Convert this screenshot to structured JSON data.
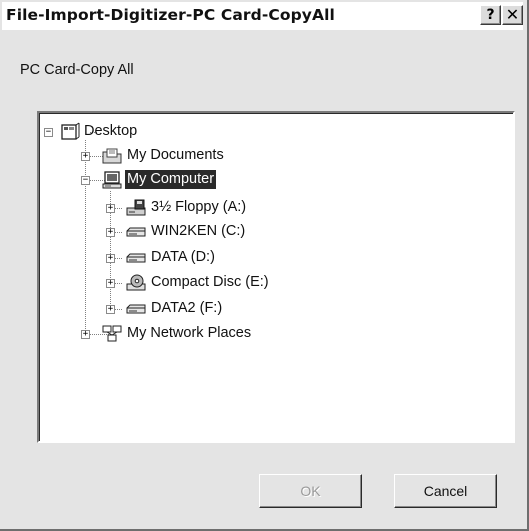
{
  "window": {
    "title": "File-Import-Digitizer-PC Card-CopyAll",
    "help_button": "?",
    "close_button": "✕"
  },
  "dialog": {
    "subtitle": "PC Card-Copy All"
  },
  "tree": {
    "root": {
      "label": "Desktop",
      "icon": "desktop-icon",
      "expanded": true
    },
    "my_documents": {
      "label": "My Documents",
      "icon": "folder-documents-icon",
      "expanded": false
    },
    "my_computer": {
      "label": "My Computer",
      "icon": "computer-icon",
      "expanded": true,
      "selected": true
    },
    "drives": [
      {
        "label": "3½ Floppy (A:)",
        "icon": "floppy-drive-icon"
      },
      {
        "label": "WIN2KEN (C:)",
        "icon": "hard-drive-icon"
      },
      {
        "label": "DATA (D:)",
        "icon": "hard-drive-icon"
      },
      {
        "label": "Compact Disc (E:)",
        "icon": "cd-drive-icon"
      },
      {
        "label": "DATA2 (F:)",
        "icon": "hard-drive-icon"
      }
    ],
    "network": {
      "label": "My Network Places",
      "icon": "network-places-icon",
      "expanded": false
    }
  },
  "buttons": {
    "ok_label": "OK",
    "ok_enabled": false,
    "cancel_label": "Cancel"
  }
}
